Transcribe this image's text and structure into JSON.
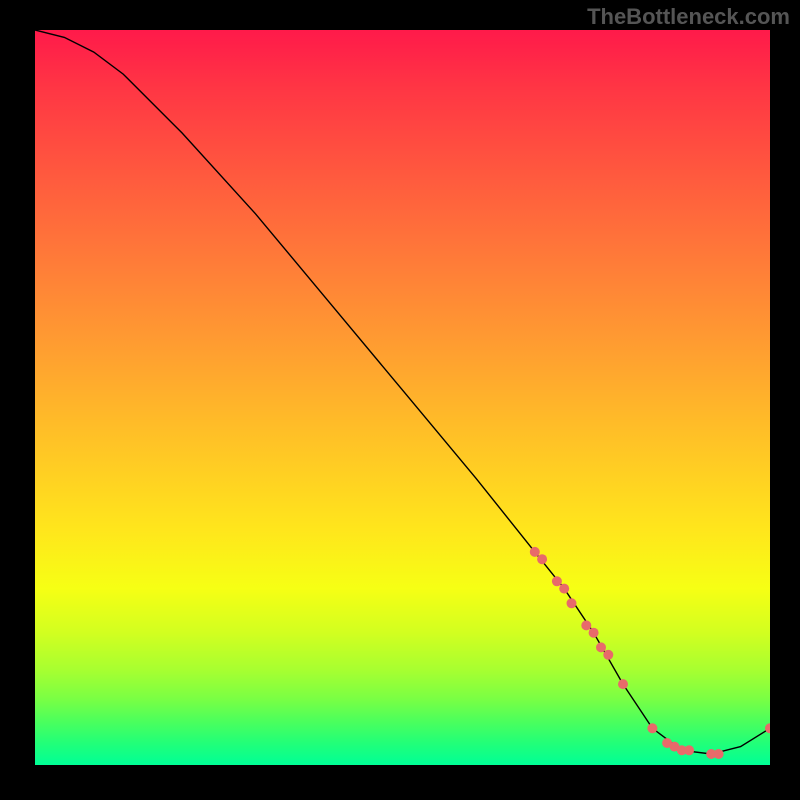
{
  "watermark": "TheBottleneck.com",
  "chart_data": {
    "type": "line",
    "title": "",
    "xlabel": "",
    "ylabel": "",
    "xlim": [
      0,
      100
    ],
    "ylim": [
      0,
      100
    ],
    "series": [
      {
        "name": "curve",
        "x": [
          0,
          4,
          8,
          12,
          20,
          30,
          40,
          50,
          60,
          68,
          72,
          76,
          80,
          84,
          88,
          92,
          96,
          100
        ],
        "values": [
          100,
          99,
          97,
          94,
          86,
          75,
          63,
          51,
          39,
          29,
          24,
          18,
          11,
          5,
          2,
          1.5,
          2.5,
          5
        ]
      }
    ],
    "highlight_points": {
      "name": "dots",
      "x": [
        68,
        69,
        71,
        72,
        73,
        75,
        76,
        77,
        78,
        80,
        84,
        86,
        87,
        88,
        89,
        92,
        93,
        100
      ],
      "values": [
        29,
        28,
        25,
        24,
        22,
        19,
        18,
        16,
        15,
        11,
        5,
        3,
        2.5,
        2,
        2,
        1.5,
        1.5,
        5
      ]
    },
    "gradient_colors": [
      "#ff1a4a",
      "#ff7d38",
      "#ffe61c",
      "#00ff96"
    ],
    "dot_color": "#e86a6a",
    "line_color": "#000000"
  }
}
